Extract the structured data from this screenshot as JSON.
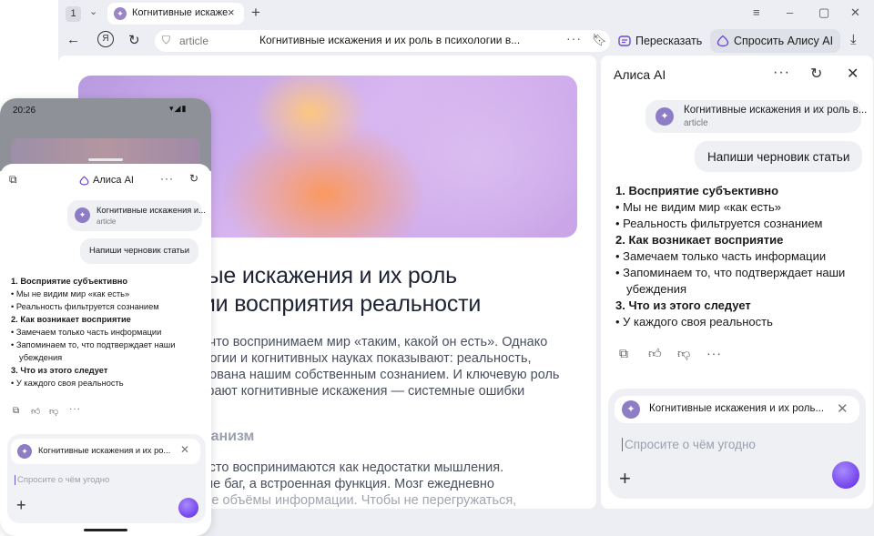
{
  "browser": {
    "tab_count": "1",
    "tab_title": "Когнитивные искаже",
    "address": {
      "host": "article",
      "title": "Когнитивные искажения и их роль в психологии в..."
    },
    "summarize_label": "Пересказать",
    "ask_alice_label": "Спросить Алису AI"
  },
  "article": {
    "title_line1": "ные искажения и их роль",
    "title_line2": "гии восприятия реальности",
    "para1": [
      "ь, что воспринимаем мир «таким, какой он есть». Однако",
      "ологии и когнитивных науках показывают: реальность,",
      "ирована нашим собственным сознанием. И ключевую роль",
      "играют когнитивные искажения — системные ошибки"
    ],
    "heading2": "еханизм",
    "para2": [
      "часто воспринимаются как недостатки мышления.",
      "о не баг, а встроенная функция. Мозг ежедневно",
      "ные объёмы информации. Чтобы не перегружаться,"
    ]
  },
  "panel": {
    "title": "Алиса AI",
    "context_title": "Когнитивные искажения и их роль в...",
    "context_source": "article",
    "user_message": "Напиши черновик статьи",
    "answer": {
      "s1": "1. Восприятие субъективно",
      "s1_b1": "Мы не видим мир «как есть»",
      "s1_b2": "Реальность фильтруется сознанием",
      "s2": "2. Как возникает восприятие",
      "s2_b1": "Замечаем только часть информации",
      "s2_b2": "Запоминаем то, что подтверждает наши убеждения",
      "s3": "3. Что из этого следует",
      "s3_b1": "У каждого своя реальность"
    },
    "composer_context": "Когнитивные искажения и их роль...",
    "composer_placeholder": "Спросите о чём угодно"
  },
  "phone": {
    "time": "20:26",
    "title": "Алиса AI",
    "context_title": "Когнитивные искажения и...",
    "context_source": "article",
    "user_message": "Напиши черновик статьи",
    "composer_context": "Когнитивные искажения и их ро...",
    "composer_placeholder": "Спросите о чём угодно"
  },
  "colors": {
    "alice_accent": "#7b4df0",
    "sparkle": "#8e7cc4",
    "chrome_bg": "#eceef3"
  }
}
